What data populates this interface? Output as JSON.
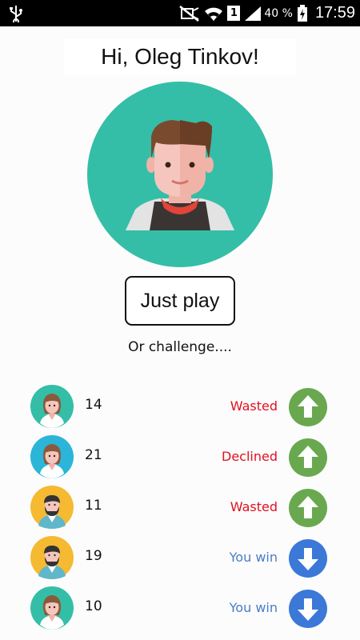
{
  "status_bar": {
    "battery_percent": "40 %",
    "sim_slot": "1",
    "time": "17:59",
    "icons": [
      "usb-icon",
      "mute-icon",
      "wifi-icon",
      "sim-icon",
      "signal-icon",
      "battery-icon"
    ]
  },
  "greeting": "Hi, Oleg Tinkov!",
  "profile": {
    "avatar_icon": "man-avatar-icon",
    "avatar_bg": "#34bea7"
  },
  "play_button": "Just play",
  "challenge_label": "Or challenge....",
  "colors": {
    "status_red": "#e01020",
    "status_blue": "#4a7dc4",
    "arrow_up_bg": "#6aa84f",
    "arrow_down_bg": "#3b78d8"
  },
  "challenges": [
    {
      "avatar": "woman-avatar-icon",
      "avatar_bg": "#34bea7",
      "score": "14",
      "status": "Wasted",
      "status_color": "#e01020",
      "arrow": "up-arrow-icon"
    },
    {
      "avatar": "woman-avatar-icon",
      "avatar_bg": "#2bb5d8",
      "score": "21",
      "status": "Declined",
      "status_color": "#e01020",
      "arrow": "up-arrow-icon"
    },
    {
      "avatar": "bearded-man-avatar-icon",
      "avatar_bg": "#f6b932",
      "score": "11",
      "status": "Wasted",
      "status_color": "#e01020",
      "arrow": "up-arrow-icon"
    },
    {
      "avatar": "bearded-man-avatar-icon",
      "avatar_bg": "#f6b932",
      "score": "19",
      "status": "You win",
      "status_color": "#4a7dc4",
      "arrow": "down-arrow-icon"
    },
    {
      "avatar": "woman-avatar-icon",
      "avatar_bg": "#34bea7",
      "score": "10",
      "status": "You win",
      "status_color": "#4a7dc4",
      "arrow": "down-arrow-icon"
    }
  ]
}
